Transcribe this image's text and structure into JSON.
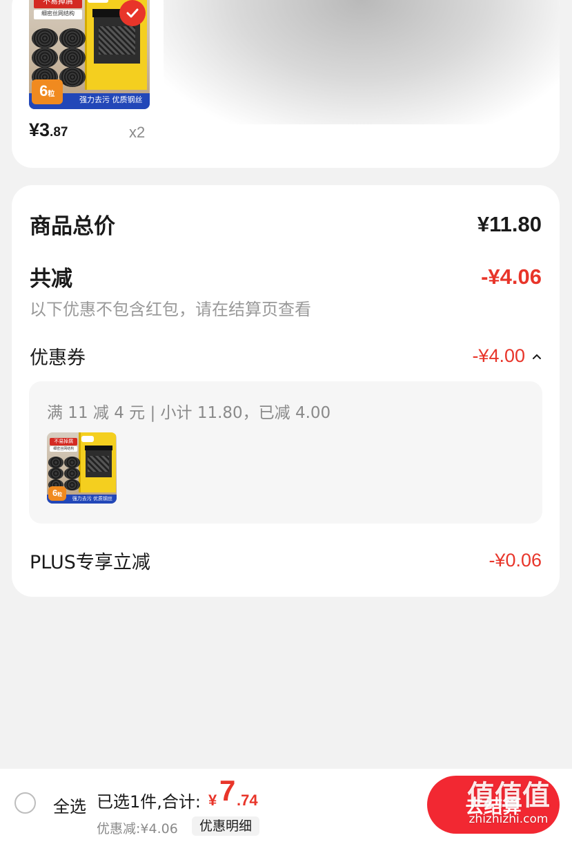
{
  "product": {
    "price_main": "¥3",
    "price_decimal": ".87",
    "quantity": "x2",
    "image_tags": {
      "tag_red": "不易掉屑",
      "tag_white": "细密丝网结构",
      "strip": "强力去污 优质钢丝",
      "count": "6",
      "count_unit": "粒"
    }
  },
  "summary": {
    "total_label": "商品总价",
    "total_value": "¥11.80",
    "reduce_label": "共减",
    "reduce_value": "-¥4.06",
    "note": "以下优惠不包含红包，请在结算页查看",
    "coupon_label": "优惠券",
    "coupon_value": "-¥4.00",
    "coupon_detail": "满 11 减 4 元 | 小计 11.80，已减 4.00",
    "plus_label": "PLUS专享立减",
    "plus_value": "-¥0.06"
  },
  "bottom_bar": {
    "select_all": "全选",
    "selected_text": "已选1件,合计:",
    "total_symbol": "¥",
    "total_int": "7",
    "total_decimal": ".74",
    "discount_text": "优惠减:¥4.06",
    "detail_button": "优惠明细",
    "settle_button": "去结算"
  },
  "watermark": {
    "logo_text": "值值值",
    "site": "zhizhizhi.com"
  },
  "colors": {
    "accent_red": "#e8352a",
    "button_red": "#f22832",
    "page_bg": "#f2f2f2"
  }
}
